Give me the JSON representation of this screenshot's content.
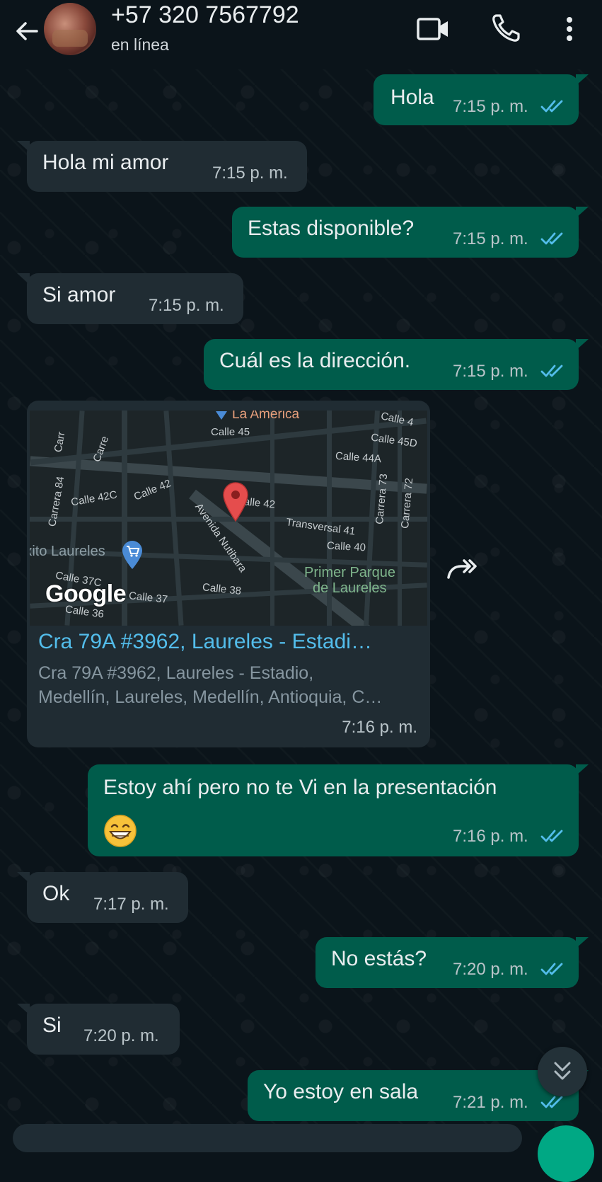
{
  "header": {
    "contact_name": "+57 320 7567792",
    "status": "en línea"
  },
  "messages": [
    {
      "direction": "out",
      "text": "Hola",
      "time": "7:15 p. m.",
      "read": true
    },
    {
      "direction": "in",
      "text": "Hola mi amor",
      "time": "7:15 p. m."
    },
    {
      "direction": "out",
      "text": "Estas disponible?",
      "time": "7:15 p. m.",
      "read": true
    },
    {
      "direction": "in",
      "text": "Si amor",
      "time": "7:15 p. m."
    },
    {
      "direction": "out",
      "text": "Cuál es la dirección.",
      "time": "7:15 p. m.",
      "read": true
    },
    {
      "direction": "in",
      "type": "location",
      "time": "7:16 p. m."
    },
    {
      "direction": "out",
      "text": "Estoy ahí pero no te Vi en la presentación",
      "emoji": "grinning-face-icon",
      "time": "7:16 p. m.",
      "read": true
    },
    {
      "direction": "in",
      "text": "Ok",
      "time": "7:17 p. m."
    },
    {
      "direction": "out",
      "text": "No estás?",
      "time": "7:20 p. m.",
      "read": true
    },
    {
      "direction": "in",
      "text": "Si",
      "time": "7:20 p. m."
    },
    {
      "direction": "out",
      "text": "Yo estoy en sala",
      "time": "7:21 p. m.",
      "read": true
    }
  ],
  "location": {
    "title": "Cra 79A #3962, Laureles - Estadi…",
    "address_line1": "Cra 79A #3962, Laureles - Estadio,",
    "address_line2": "Medellín, Laureles, Medellín, Antioquia, C…",
    "map": {
      "google_logo": "Google",
      "labels": {
        "la_america": "La America",
        "calle45": "Calle 45",
        "calle45_top": "Calle 4",
        "calle45d": "Calle 45D",
        "calle44a": "Calle 44A",
        "carrera84": "Carrera 84",
        "calle42c": "Calle 42C",
        "calle42a": "Calle 42",
        "avenida_nutibara": "Avenida Nutibara",
        "calle42b": "Calle 42",
        "carrera73": "Carrera 73",
        "carrera72": "Carrera 72",
        "transversal41": "Transversal 41",
        "calle40": "Calle 40",
        "exito": "Éxito Laureles",
        "primer_parque_1": "Primer Parque",
        "primer_parque_2": "de Laureles",
        "calle37c": "Calle 37C",
        "calle37": "Calle 37",
        "calle38": "Calle 38",
        "calle36": "Calle 36",
        "carre1": "Carre",
        "carr2": "Carr"
      }
    }
  },
  "colors": {
    "background": "#0b141a",
    "outgoing_bubble": "#005c4b",
    "incoming_bubble": "#202c33",
    "read_ticks": "#53bdeb",
    "link": "#53bdeb"
  }
}
